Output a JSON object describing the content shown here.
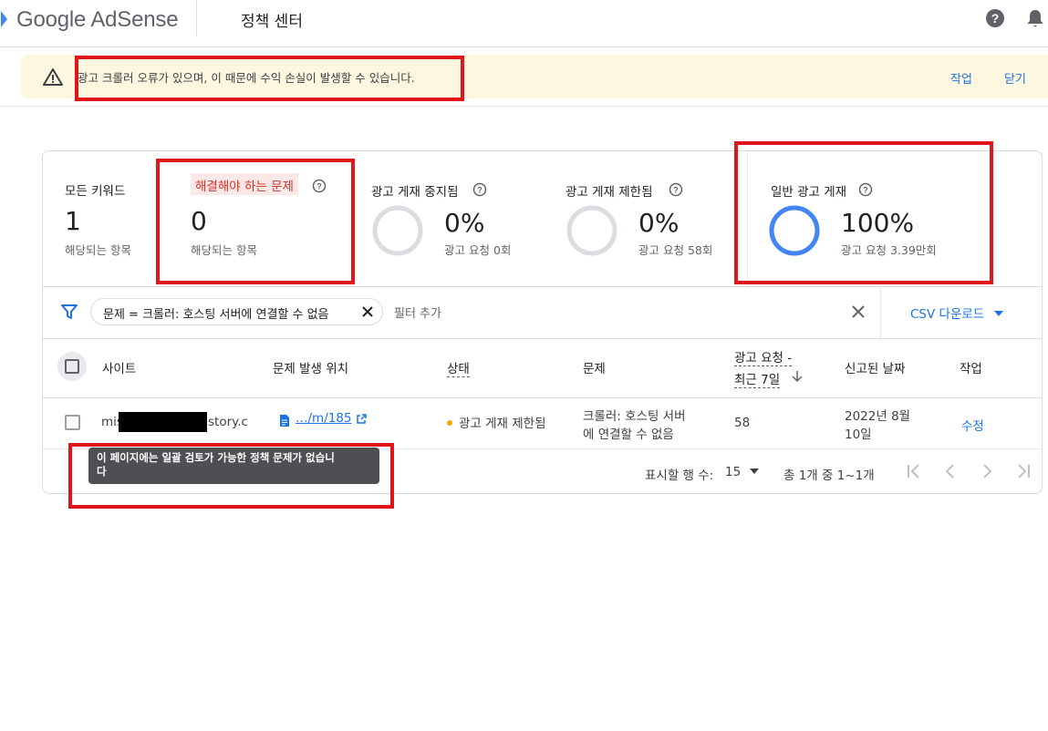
{
  "header": {
    "logo": "Google AdSense",
    "page_title": "정책 센터",
    "help_icon": "help-circle-icon",
    "notifications_icon": "bell-icon"
  },
  "banner": {
    "icon": "warning-triangle-icon",
    "message": "광고 크롤러 오류가 있으며, 이 때문에 수익 손실이 발생할 수 있습니다.",
    "action_label": "작업",
    "close_label": "닫기"
  },
  "summary": {
    "all_keywords": {
      "label": "모든 키워드",
      "value": "1",
      "sub": "해당되는 항목"
    },
    "issues_to_fix": {
      "label": "해결해야 하는 문제",
      "value": "0",
      "sub": "해당되는 항목"
    },
    "ads_stopped": {
      "label": "광고 게재 중지됨",
      "value": "0%",
      "sub": "광고 요청 0회",
      "fraction": 0
    },
    "ads_limited": {
      "label": "광고 게재 제한됨",
      "value": "0%",
      "sub": "광고 요청 58회",
      "fraction": 0
    },
    "ads_normal": {
      "label": "일반 광고 게재",
      "value": "100%",
      "sub": "광고 요청 3.39만회",
      "fraction": 1
    }
  },
  "filter": {
    "chip_text": "문제 = 크롤러: 호스팅 서버에 연결할 수 없음",
    "add_filter_label": "필터 추가",
    "csv_label": "CSV 다운로드"
  },
  "table": {
    "columns": {
      "site": "사이트",
      "location": "문제 발생 위치",
      "status": "상태",
      "issue": "문제",
      "requests_line1": "광고 요청 -",
      "requests_line2": "최근 7일",
      "reported": "신고된 날짜",
      "action": "작업"
    },
    "rows": [
      {
        "site_prefix": "mis",
        "site_suffix": "story.c",
        "location": "…/m/185",
        "status": "광고 게재 제한됨",
        "issue_line1": "크롤러: 호스팅 서버",
        "issue_line2": "에 연결할 수 없음",
        "requests": "58",
        "reported_line1": "2022년 8월",
        "reported_line2": "10일",
        "action": "수정"
      }
    ]
  },
  "pagination": {
    "rows_label": "표시할 행 수:",
    "rows_value": "15",
    "range_text": "총 1개 중 1~1개"
  },
  "tooltip": {
    "line1": "이 페이지에는 일괄 검토가 가능한 정책 문제가 없습니",
    "line2": "다"
  },
  "colors": {
    "accent_blue": "#1a73e8",
    "warning_yellow_bg": "#fef7e0",
    "issue_red": "#d93025",
    "highlight_red": "#e0151c",
    "status_dot": "#f9ab00"
  }
}
